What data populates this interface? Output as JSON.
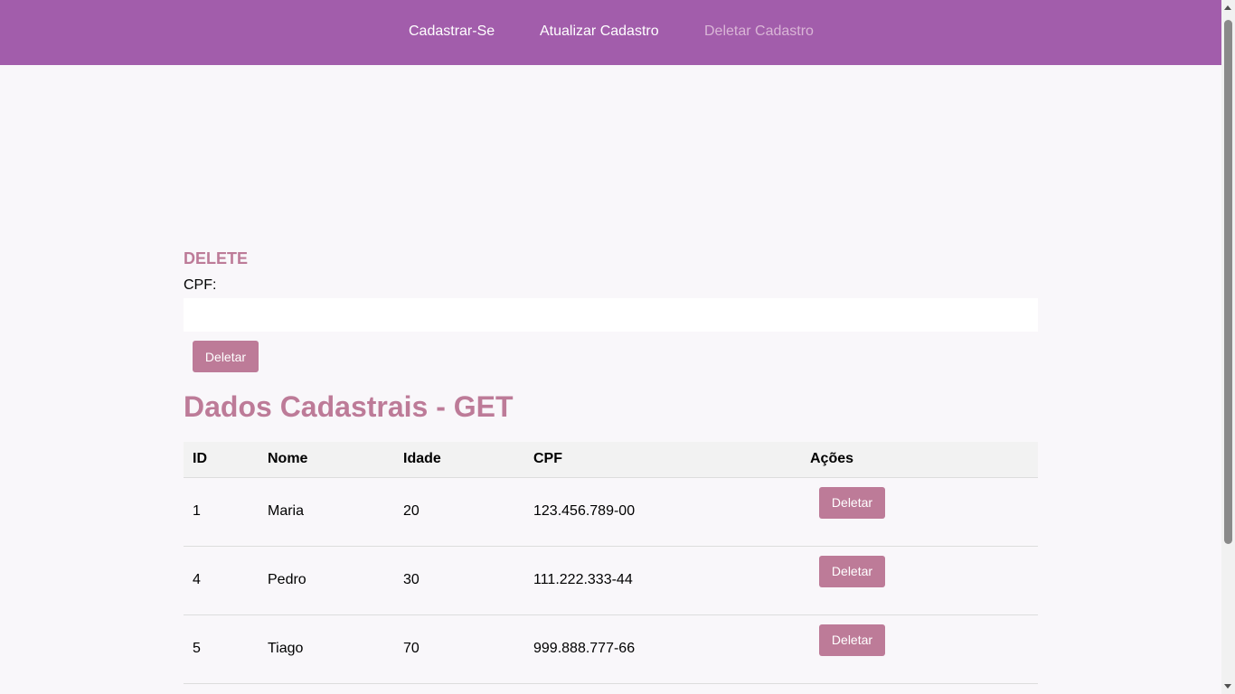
{
  "nav": {
    "items": [
      {
        "label": "Cadastrar-Se",
        "active": false
      },
      {
        "label": "Atualizar Cadastro",
        "active": false
      },
      {
        "label": "Deletar Cadastro",
        "active": true
      }
    ]
  },
  "delete_form": {
    "title": "DELETE",
    "cpf_label": "CPF:",
    "cpf_value": "",
    "cpf_placeholder": "",
    "submit_label": "Deletar"
  },
  "get_section": {
    "title": "Dados Cadastrais - GET",
    "columns": [
      "ID",
      "Nome",
      "Idade",
      "CPF",
      "Ações"
    ],
    "rows": [
      {
        "id": "1",
        "nome": "Maria",
        "idade": "20",
        "cpf": "123.456.789-00",
        "action_label": "Deletar"
      },
      {
        "id": "4",
        "nome": "Pedro",
        "idade": "30",
        "cpf": "111.222.333-44",
        "action_label": "Deletar"
      },
      {
        "id": "5",
        "nome": "Tiago",
        "idade": "70",
        "cpf": "999.888.777-66",
        "action_label": "Deletar"
      }
    ]
  },
  "colors": {
    "navbar": "#a25dab",
    "accent": "#bd7b98",
    "background": "#f9f7fa"
  }
}
